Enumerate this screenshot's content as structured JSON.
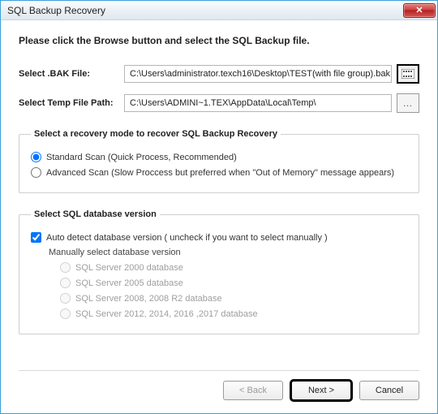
{
  "window": {
    "title": "SQL Backup Recovery"
  },
  "instruction": "Please click the Browse button and select the SQL Backup file.",
  "bak": {
    "label": "Select .BAK File:",
    "value": "C:\\Users\\administrator.texch16\\Desktop\\TEST(with file group).bak"
  },
  "temp": {
    "label": "Select Temp File Path:",
    "value": "C:\\Users\\ADMINI~1.TEX\\AppData\\Local\\Temp\\"
  },
  "recovery": {
    "legend": "Select a recovery mode to recover SQL Backup Recovery",
    "standard": "Standard Scan (Quick Process, Recommended)",
    "advanced": "Advanced Scan (Slow Proccess but preferred when \"Out of Memory\" message appears)"
  },
  "version": {
    "legend": "Select SQL database version",
    "auto": "Auto detect database version ( uncheck if you want to select manually )",
    "manual_label": "Manually select database version",
    "opts": [
      "SQL Server 2000 database",
      "SQL Server 2005 database",
      "SQL Server 2008, 2008 R2 database",
      "SQL Server 2012, 2014, 2016 ,2017 database"
    ]
  },
  "buttons": {
    "back": "< Back",
    "next": "Next >",
    "cancel": "Cancel"
  }
}
